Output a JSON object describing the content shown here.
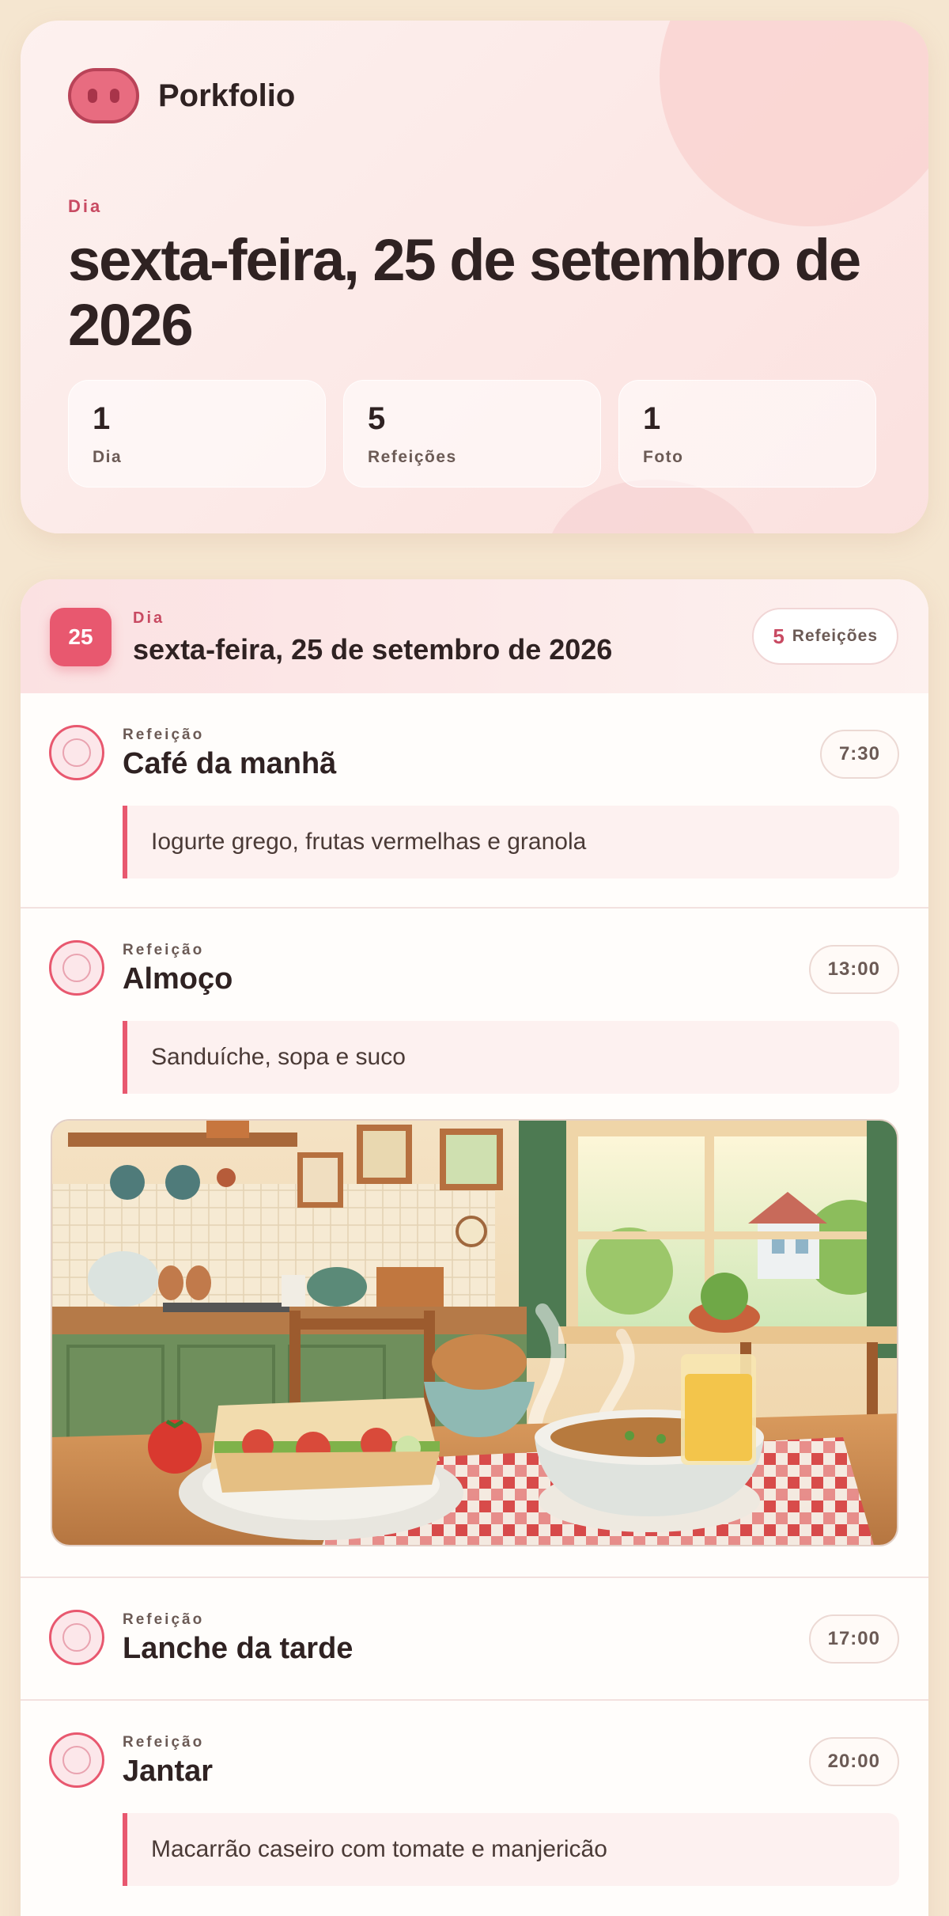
{
  "app": {
    "brand": "Porkfolio"
  },
  "hero": {
    "eyebrow": "Dia",
    "title": "sexta-feira, 25 de setembro de 2026",
    "stats": [
      {
        "value": "1",
        "label": "Dia"
      },
      {
        "value": "5",
        "label": "Refeições"
      },
      {
        "value": "1",
        "label": "Foto"
      }
    ]
  },
  "day": {
    "badge": "25",
    "eyebrow": "Dia",
    "title": "sexta-feira, 25 de setembro de 2026",
    "count_value": "5",
    "count_label": "Refeições"
  },
  "meals": [
    {
      "eyebrow": "Refeição",
      "name": "Café da manhã",
      "time": "7:30",
      "note": "Iogurte grego, frutas vermelhas e granola"
    },
    {
      "eyebrow": "Refeição",
      "name": "Almoço",
      "time": "13:00",
      "note": "Sanduíche, sopa e suco"
    },
    {
      "eyebrow": "Refeição",
      "name": "Lanche da tarde",
      "time": "17:00"
    },
    {
      "eyebrow": "Refeição",
      "name": "Jantar",
      "time": "20:00",
      "note": "Macarrão caseiro com tomate e manjericão"
    }
  ],
  "colors": {
    "accent": "#e8586f",
    "background": "#f5e6d0",
    "text": "#2f2222"
  }
}
